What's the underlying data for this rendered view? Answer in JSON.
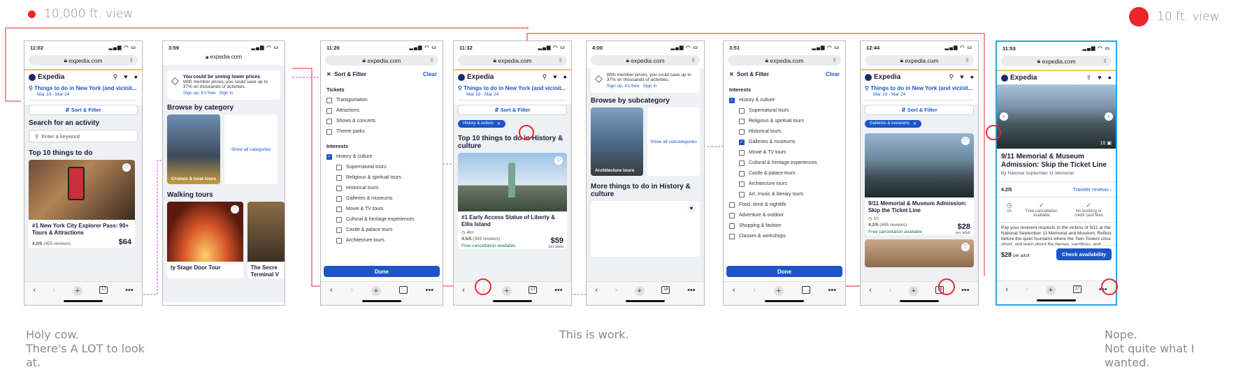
{
  "headers": {
    "left": "10,000 ft. view",
    "right": "10 ft. view"
  },
  "captions": {
    "left": [
      "Holy cow.",
      "There's A LOT to look",
      "at."
    ],
    "middle": "This is work.",
    "right": [
      "Nope.",
      "Not quite what I",
      "wanted."
    ]
  },
  "colors": {
    "red": "#e8262b",
    "brand_blue": "#1d55c7",
    "navy": "#1b1b3a",
    "highlight_border": "#2aa3e6"
  },
  "common": {
    "url": "expedia.com",
    "brand": "Expedia",
    "search_title": "Things to do in New York (and vicinit...",
    "search_dates": "Mar 19 - Mar 24",
    "sort_filter": "Sort & Filter",
    "clear": "Clear",
    "done": "Done"
  },
  "s1": {
    "time": "11:02",
    "search_activity": "Search for an activity",
    "keyword_placeholder": "Enter a keyword",
    "top10": "Top 10 things to do",
    "card_title": "#1 New York City Explorer Pass: 90+ Tours & Attractions",
    "rating": "4.0/5",
    "reviews": "(455 reviews)",
    "price": "$64",
    "tabs": "17"
  },
  "s2": {
    "time": "3:59",
    "banner_title": "You could be seeing lower prices",
    "banner_body": "With member prices, you could save up to 37% on thousands of activities.",
    "signup": "Sign up, it's free",
    "signin": "Sign in",
    "browse_category": "Browse by category",
    "cruises": "Cruises & boat tours",
    "show_all_categories": "Show all categories",
    "walking_tours": "Walking tours",
    "card1": "ty Stage Door Tour",
    "card2": "The Secre Terminal V"
  },
  "s3": {
    "time": "11:26",
    "tickets": "Tickets",
    "ticket_items": [
      "Transportation",
      "Attractions",
      "Shows & concerts",
      "Theme parks"
    ],
    "interests": "Interests",
    "history": "History & culture",
    "history_sub": [
      "Supernatural tours",
      "Religious & spiritual tours",
      "Historical tours",
      "Galleries & museums",
      "Movie & TV tours",
      "Cultural & heritage experiences",
      "Castle & palace tours",
      "Architecture tours"
    ]
  },
  "s4": {
    "time": "11:32",
    "chip": "History & culture",
    "heading": "Top 10 things to do in History & culture",
    "card_title": "#1 Early Access Statue of Liberty & Ellis Island",
    "duration": "4h+",
    "rating": "4.5/5",
    "reviews": "(359 reviews)",
    "price": "$59",
    "per_adult": "per adult",
    "free_cancel": "Free cancellation available",
    "tabs": "17"
  },
  "s5": {
    "time": "4:00",
    "banner_body": "With member prices, you could save up to 37% on thousands of activities.",
    "signup": "Sign up, it's free",
    "signin": "Sign in",
    "browse_sub": "Browse by subcategory",
    "arch": "Architecture tours",
    "show_all_sub": "Show all subcategories",
    "more": "More things to do in History & culture",
    "tabs": "18"
  },
  "s6": {
    "time": "3:51",
    "interests": "Interests",
    "history": "History & culture",
    "sub": [
      "Supernatural tours",
      "Religious & spiritual tours",
      "Historical tours",
      "Galleries & museums",
      "Movie & TV tours",
      "Cultural & heritage experiences",
      "Castle & palace tours",
      "Architecture tours",
      "Art, music & literary tours"
    ],
    "others": [
      "Food, drink & nightlife",
      "Adventure & outdoor",
      "Shopping & fashion",
      "Classes & workshops"
    ]
  },
  "s7": {
    "time": "12:44",
    "chip": "Galleries & museums",
    "card_title": "9/11 Memorial & Museum Admission: Skip the Ticket Line",
    "duration": "1h",
    "rating": "4.2/5",
    "reviews": "(495 reviews)",
    "price": "$28",
    "per_adult": "per adult",
    "free_cancel": "Free cancellation available",
    "tabs": "19"
  },
  "s8": {
    "time": "11:53",
    "photo_count": "10",
    "title": "9/11 Memorial & Museum Admission: Skip the Ticket Line",
    "by": "By National September 11 Memorial",
    "rating": "4.2/5",
    "traveler_reviews": "Traveler reviews",
    "feat1": "1h",
    "feat2": "Free cancellation available",
    "feat3": "No booking or credit card fees",
    "desc": "Pay your reverent respects to the victims of 9/11 at the National September 11 Memorial and Museum. Reflect before the quiet fountains where the Twin Towers once stood, and learn about the heroes, sacrifices, and",
    "price": "$28",
    "per_adult": "per adult",
    "cta": "Check availability",
    "tabs": "17"
  }
}
